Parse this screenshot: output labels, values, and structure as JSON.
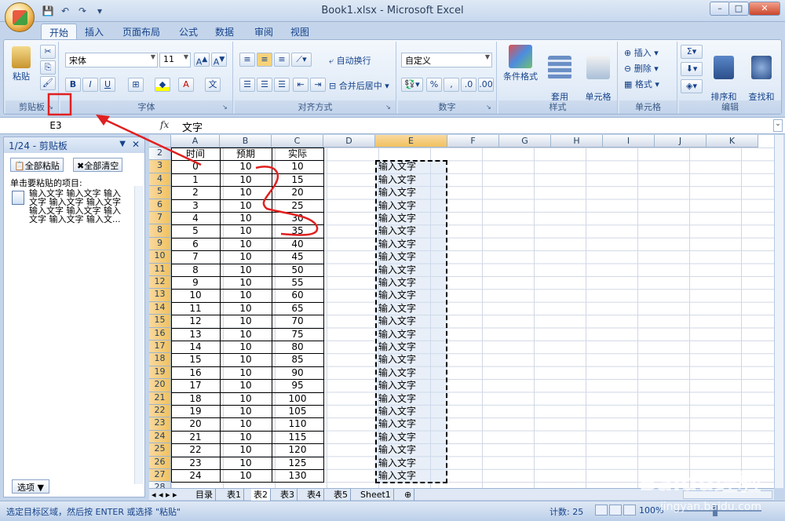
{
  "window": {
    "title": "Book1.xlsx - Microsoft Excel"
  },
  "tabs": [
    "开始",
    "插入",
    "页面布局",
    "公式",
    "数据",
    "审阅",
    "视图"
  ],
  "ribbon": {
    "clipboard": {
      "label": "剪贴板",
      "paste": "粘贴"
    },
    "font": {
      "label": "字体",
      "name": "宋体",
      "size": "11",
      "bold": "B",
      "italic": "I",
      "underline": "U"
    },
    "alignment": {
      "label": "对齐方式",
      "wrap": "自动换行",
      "merge": "合并后居中"
    },
    "number": {
      "label": "数字",
      "format": "自定义",
      "percent": "%",
      "comma": ","
    },
    "styles": {
      "label": "样式",
      "conditional": "条件格式",
      "table": "套用\n表格格式",
      "cell": "单元格\n样式"
    },
    "cells": {
      "label": "单元格",
      "insert": "插入",
      "delete": "删除",
      "format": "格式"
    },
    "editing": {
      "label": "编辑",
      "sort": "排序和\n筛选",
      "find": "查找和\n选择"
    }
  },
  "formula_bar": {
    "name_box": "E3",
    "fx": "fx",
    "content": "文字"
  },
  "clipboard_pane": {
    "title": "1/24 - 剪贴板",
    "paste_all": "全部粘贴",
    "clear_all": "全部清空",
    "hint": "单击要粘贴的项目:",
    "item": "输入文字 输入文字 输入文字 输入文字 输入文字 输入文字 输入文字 输入文字 输入文字 输入文...",
    "options": "选项 ▼"
  },
  "grid": {
    "columns": [
      "A",
      "B",
      "C",
      "D",
      "E",
      "F",
      "G",
      "H",
      "I",
      "J",
      "K"
    ],
    "header": {
      "row": "2",
      "a": "时间",
      "b": "预期",
      "c": "实际"
    },
    "rows": [
      [
        "3",
        "0",
        "10",
        "10"
      ],
      [
        "4",
        "1",
        "10",
        "15"
      ],
      [
        "5",
        "2",
        "10",
        "20"
      ],
      [
        "6",
        "3",
        "10",
        "25"
      ],
      [
        "7",
        "4",
        "10",
        "30"
      ],
      [
        "8",
        "5",
        "10",
        "35"
      ],
      [
        "9",
        "6",
        "10",
        "40"
      ],
      [
        "10",
        "7",
        "10",
        "45"
      ],
      [
        "11",
        "8",
        "10",
        "50"
      ],
      [
        "12",
        "9",
        "10",
        "55"
      ],
      [
        "13",
        "10",
        "10",
        "60"
      ],
      [
        "14",
        "11",
        "10",
        "65"
      ],
      [
        "15",
        "12",
        "10",
        "70"
      ],
      [
        "16",
        "13",
        "10",
        "75"
      ],
      [
        "17",
        "14",
        "10",
        "80"
      ],
      [
        "18",
        "15",
        "10",
        "85"
      ],
      [
        "19",
        "16",
        "10",
        "90"
      ],
      [
        "20",
        "17",
        "10",
        "95"
      ],
      [
        "21",
        "18",
        "10",
        "100"
      ],
      [
        "22",
        "19",
        "10",
        "105"
      ],
      [
        "23",
        "20",
        "10",
        "110"
      ],
      [
        "24",
        "21",
        "10",
        "115"
      ],
      [
        "25",
        "22",
        "10",
        "120"
      ],
      [
        "26",
        "23",
        "10",
        "125"
      ],
      [
        "27",
        "24",
        "10",
        "130"
      ]
    ],
    "e_text": "输入文字",
    "row_28": "28"
  },
  "sheets": [
    "目录",
    "表1",
    "表2",
    "表3",
    "表4",
    "表5",
    "Sheet1"
  ],
  "status": {
    "message": "选定目标区域，然后按 ENTER 或选择 \"粘贴\"",
    "count": "计数: 25",
    "zoom": "100%"
  },
  "watermark": {
    "main": "Baidu经验",
    "sub": "jingyan.baidu.com"
  },
  "colors": {
    "accent": "#15428b",
    "selection": "#f1c15f",
    "annotation": "#e02020"
  }
}
